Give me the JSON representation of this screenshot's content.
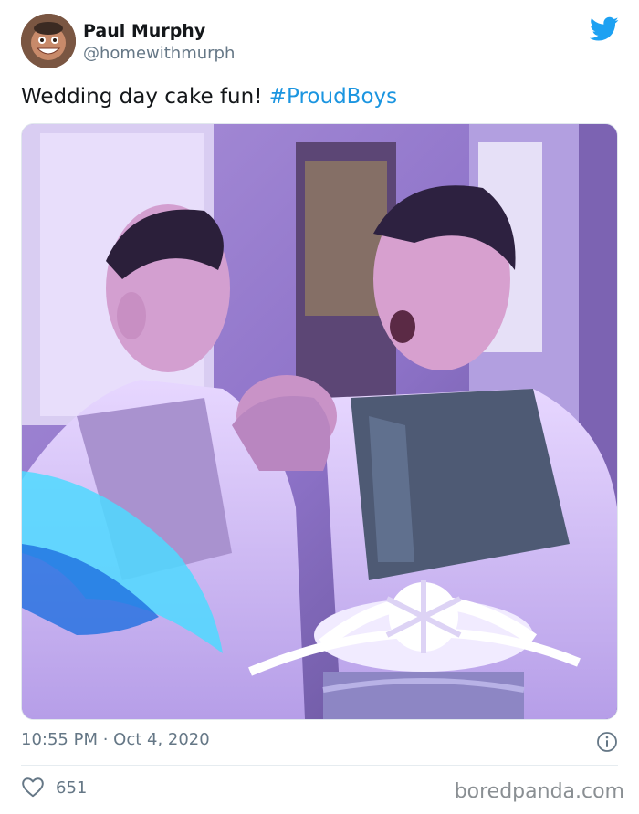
{
  "tweet": {
    "author": {
      "display_name": "Paul Murphy",
      "handle": "@homewithmurph",
      "avatar_icon": "avatar-icon"
    },
    "text_plain": "Wedding day cake fun! ",
    "text_hashtag": "#ProudBoys",
    "timestamp": "10:55 PM · Oct 4, 2020",
    "likes": "651",
    "photo_icon": "photo-image",
    "brand_icon": "twitter-bird-icon"
  },
  "watermark": "boredpanda.com",
  "colors": {
    "brand": "#1da1f2",
    "hashtag": "#1b95e0",
    "muted": "#657786"
  }
}
